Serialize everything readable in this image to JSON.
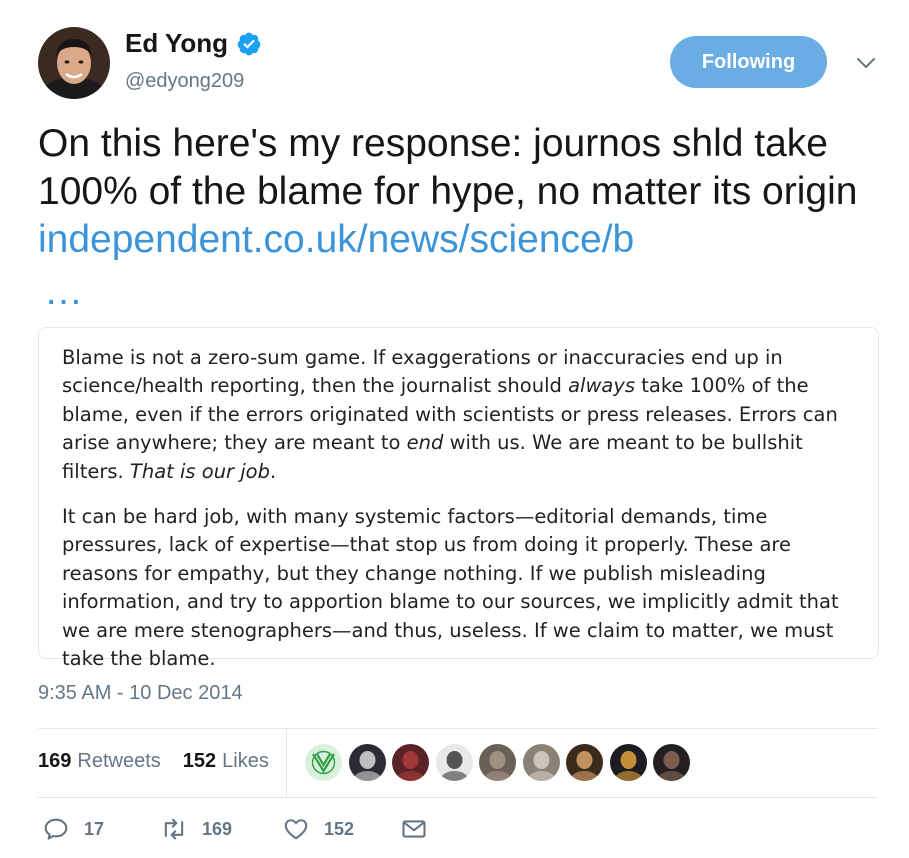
{
  "author": {
    "name": "Ed Yong",
    "handle": "@edyong209",
    "verified": true,
    "avatar_icon": "author-avatar"
  },
  "follow_button": {
    "label": "Following",
    "color": "#6aade4"
  },
  "menu_icon": "chevron-down-icon",
  "tweet": {
    "text": "On this  here's my response: journos shld take 100% of the blame for hype, no matter its origin ",
    "link": "independent.co.uk/news/science/b",
    "ellipsis": "…",
    "link_color": "#3b94d9"
  },
  "quote_image": {
    "p1_a": "Blame is not a zero-sum game. If exaggerations  or inaccuracies  end up in science/health reporting, then the journalist should ",
    "p1_always": "always",
    "p1_b": " take 100% of the blame, even if the errors originated with scientists or press releases. Errors can arise anywhere; they are meant to ",
    "p1_end": "end",
    "p1_c": " with us. We are meant to be bullshit filters. ",
    "p1_that": "That is our job",
    "p1_d": ".",
    "p2": "It can be hard job, with many systemic factors—editorial demands, time pressures, lack of expertise—that  stop us from doing it properly. These are reasons for empathy, but they change nothing. If we publish misleading information, and try to apportion blame to our sources, we implicitly admit that we are mere stenographers—and  thus, useless. If we claim to matter, we must take the blame."
  },
  "timestamp": "9:35 AM - 10 Dec 2014",
  "stats": {
    "retweets_count": "169",
    "retweets_label": "Retweets",
    "likes_count": "152",
    "likes_label": "Likes"
  },
  "liker_avatars": [
    {
      "name": "liker-avatar-1",
      "bg": "#d9f0da",
      "fg": "#2f9e44"
    },
    {
      "name": "liker-avatar-2",
      "bg": "#2b2b33",
      "fg": "#d8d8d8"
    },
    {
      "name": "liker-avatar-3",
      "bg": "#5a2327",
      "fg": "#b03a3a"
    },
    {
      "name": "liker-avatar-4",
      "bg": "#e8e8e8",
      "fg": "#3a3a3a"
    },
    {
      "name": "liker-avatar-5",
      "bg": "#6b6055",
      "fg": "#a89b8a"
    },
    {
      "name": "liker-avatar-6",
      "bg": "#8a8275",
      "fg": "#d7d0c2"
    },
    {
      "name": "liker-avatar-7",
      "bg": "#3d2a1c",
      "fg": "#d7a36c"
    },
    {
      "name": "liker-avatar-8",
      "bg": "#1c1c22",
      "fg": "#e3a23a"
    },
    {
      "name": "liker-avatar-9",
      "bg": "#252020",
      "fg": "#8b6a58"
    }
  ],
  "actions": {
    "reply_count": "17",
    "retweet_count": "169",
    "like_count": "152"
  }
}
